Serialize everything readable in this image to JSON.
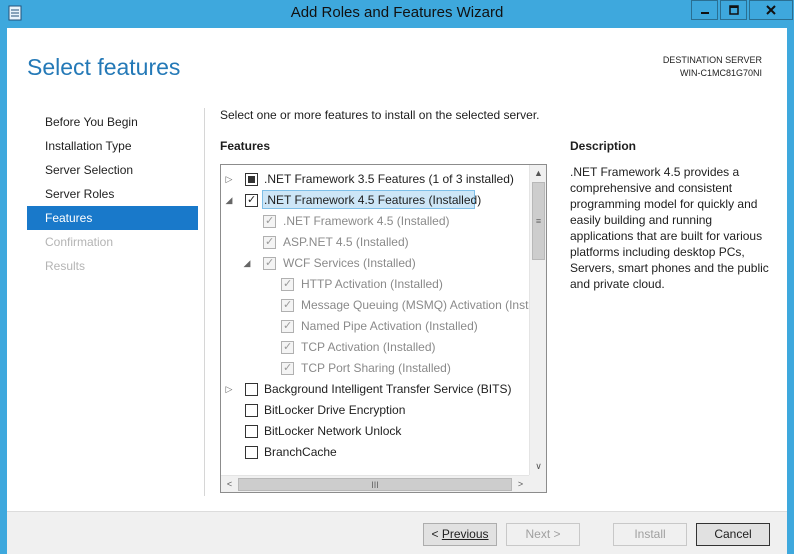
{
  "window": {
    "title": "Add Roles and Features Wizard",
    "minimize_glyph": "▁",
    "maximize_glyph": "□",
    "close_glyph": "✕",
    "chrome_color": "#3ea8dd"
  },
  "header": {
    "page_title": "Select features",
    "destination_label": "DESTINATION SERVER",
    "destination_server": "WIN-C1MC81G70NI"
  },
  "nav": {
    "items": [
      {
        "label": "Before You Begin"
      },
      {
        "label": "Installation Type"
      },
      {
        "label": "Server Selection"
      },
      {
        "label": "Server Roles"
      },
      {
        "label": "Features"
      },
      {
        "label": "Confirmation"
      },
      {
        "label": "Results"
      }
    ],
    "active_color": "#1979ca"
  },
  "main": {
    "instruction": "Select one or more features to install on the selected server.",
    "features_label": "Features",
    "description_label": "Description",
    "description_text": ".NET Framework 4.5 provides a comprehensive and consistent programming model for quickly and easily building and running applications that are built for various platforms including desktop PCs, Servers, smart phones and the public and private cloud."
  },
  "tree": {
    "rows": [
      {
        "label": ".NET Framework 3.5 Features (1 of 3 installed)"
      },
      {
        "label": ".NET Framework 4.5 Features (Installed)"
      },
      {
        "label": ".NET Framework 4.5 (Installed)"
      },
      {
        "label": "ASP.NET 4.5 (Installed)"
      },
      {
        "label": "WCF Services (Installed)"
      },
      {
        "label": "HTTP Activation (Installed)"
      },
      {
        "label": "Message Queuing (MSMQ) Activation (Insta"
      },
      {
        "label": "Named Pipe Activation (Installed)"
      },
      {
        "label": "TCP Activation (Installed)"
      },
      {
        "label": "TCP Port Sharing (Installed)"
      },
      {
        "label": "Background Intelligent Transfer Service (BITS)"
      },
      {
        "label": "BitLocker Drive Encryption"
      },
      {
        "label": "BitLocker Network Unlock"
      },
      {
        "label": "BranchCache"
      }
    ],
    "selected_color": "#cde6f7"
  },
  "scroll": {
    "up": "▲",
    "down": "∨",
    "left": "<",
    "right": ">",
    "v_grip": "≡",
    "h_grip": "III"
  },
  "footer": {
    "previous_label": "Previous",
    "previous_prefix": "< ",
    "next_label": "Next >",
    "install_label": "Install",
    "cancel_label": "Cancel"
  }
}
